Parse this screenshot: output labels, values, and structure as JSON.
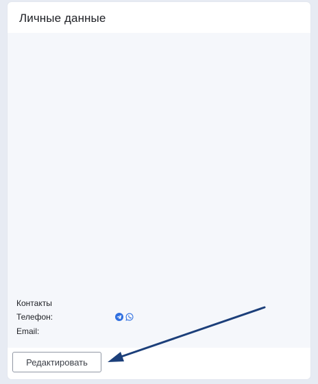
{
  "card": {
    "title": "Личные данные"
  },
  "contacts": {
    "heading": "Контакты",
    "phone_label": "Телефон:",
    "email_label": "Email:",
    "messengers": [
      {
        "icon": "telegram-icon",
        "color": "#2f6fe0"
      },
      {
        "icon": "whatsapp-icon",
        "color": "#2f6fe0"
      }
    ]
  },
  "actions": {
    "edit_label": "Редактировать"
  },
  "annotation": {
    "arrow_color": "#1c3f7a"
  }
}
